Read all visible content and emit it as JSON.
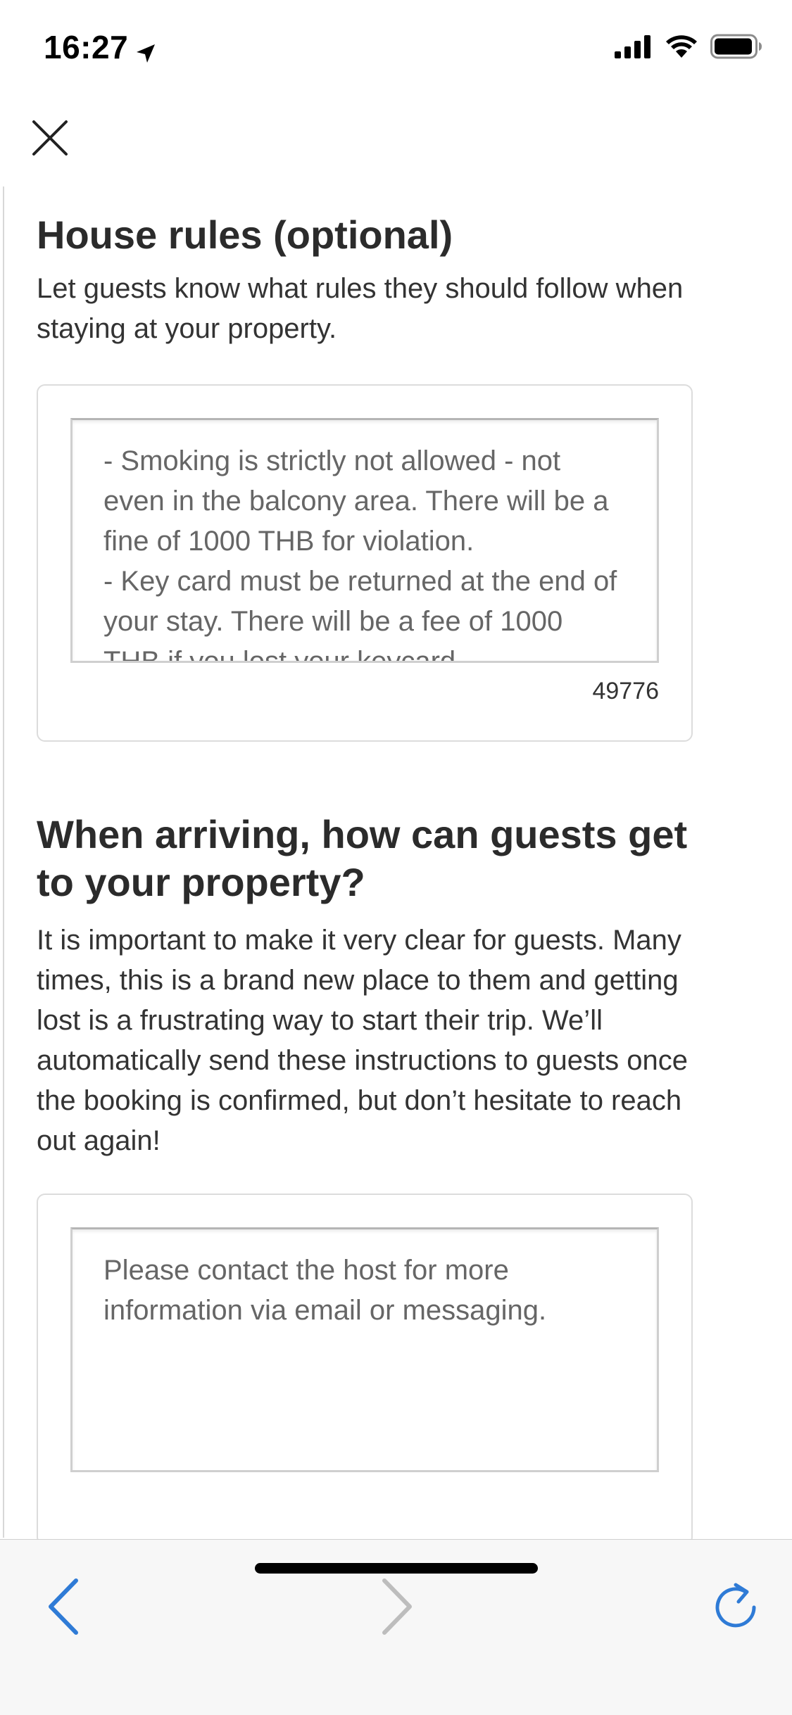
{
  "status_bar": {
    "time": "16:27",
    "location_icon": "location-arrow-icon",
    "signal_icon": "cellular-signal-icon",
    "wifi_icon": "wifi-icon",
    "battery_icon": "battery-icon"
  },
  "header": {
    "close_icon": "close-icon"
  },
  "house_rules": {
    "title": "House rules (optional)",
    "description": "Let guests know what rules they should follow when staying at your property.",
    "text": "- Smoking is strictly not allowed - not even in the balcony area. There will be a fine of 1000 THB for violation.\n- Key card must be returned at the end of your stay. There will be a fee of 1000 THB if you lost your keycard.",
    "char_count": "49776"
  },
  "arrival": {
    "title": "When arriving, how can guests get to your property?",
    "description": "It is important to make it very clear for guests. Many times, this is a brand new place to them and getting lost is a frustrating way to start their trip. We’ll automatically send these instructions to guests once the booking is confirmed, but don’t hesitate to reach out again!",
    "text": "Please contact the host for more information via email or messaging."
  },
  "toolbar": {
    "back_icon": "chevron-left-icon",
    "forward_icon": "chevron-right-icon",
    "reload_icon": "reload-icon"
  },
  "colors": {
    "accent_blue": "#2f7bd6",
    "disabled_gray": "#bdbdbd"
  }
}
